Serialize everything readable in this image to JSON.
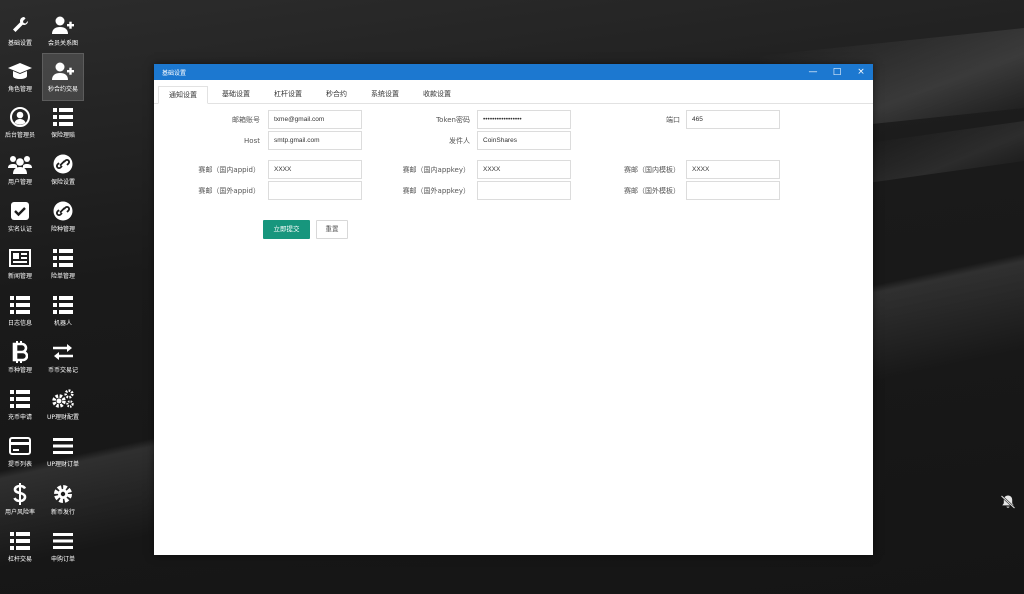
{
  "desktop": {
    "icons": [
      {
        "label": "基础设置",
        "icon": "wrench-icon"
      },
      {
        "label": "会员关系图",
        "icon": "user-add-icon"
      },
      {
        "label": "角色管理",
        "icon": "graduation-cap-icon"
      },
      {
        "label": "秒合约交易",
        "icon": "user-add-icon"
      },
      {
        "label": "后台管理员",
        "icon": "user-circle-icon"
      },
      {
        "label": "保险理赔",
        "icon": "list-icon"
      },
      {
        "label": "用户管理",
        "icon": "users-icon"
      },
      {
        "label": "保险设置",
        "icon": "link-circle-icon"
      },
      {
        "label": "实名认证",
        "icon": "check-square-icon"
      },
      {
        "label": "险种管理",
        "icon": "link-circle-icon"
      },
      {
        "label": "新闻管理",
        "icon": "newspaper-icon"
      },
      {
        "label": "险单管理",
        "icon": "list-icon"
      },
      {
        "label": "日志信息",
        "icon": "list-icon"
      },
      {
        "label": "机器人",
        "icon": "list-icon"
      },
      {
        "label": "币种管理",
        "icon": "bitcoin-icon"
      },
      {
        "label": "币币交易记",
        "icon": "exchange-icon"
      },
      {
        "label": "充币申请",
        "icon": "list-icon"
      },
      {
        "label": "UP理财配置",
        "icon": "gears-icon"
      },
      {
        "label": "提币列表",
        "icon": "credit-card-icon"
      },
      {
        "label": "UP理财订单",
        "icon": "menu-icon"
      },
      {
        "label": "用户风险率",
        "icon": "dollar-icon"
      },
      {
        "label": "新币发行",
        "icon": "gear-icon"
      },
      {
        "label": "杠杆交易",
        "icon": "list-icon"
      },
      {
        "label": "申购订单",
        "icon": "menu-icon"
      }
    ],
    "tray_icon": "bell-off-icon"
  },
  "window": {
    "title": "基础设置",
    "controls": {
      "minimize": "—",
      "maximize": "□",
      "close": "×"
    },
    "tabs": [
      "通知设置",
      "基础设置",
      "杠杆设置",
      "秒合约",
      "系统设置",
      "收款设置"
    ],
    "active_tab": 0,
    "form": {
      "row1": [
        {
          "label": "邮箱账号",
          "value": "txme@gmail.com"
        },
        {
          "label": "Token密码",
          "value": "•••••••••••••••••"
        },
        {
          "label": "端口",
          "value": "465"
        }
      ],
      "row2": [
        {
          "label": "Host",
          "value": "smtp.gmail.com"
        },
        {
          "label": "发件人",
          "value": "CoinShares"
        }
      ],
      "row3": [
        {
          "label": "赛邮（国内appid）",
          "value": "XXXX"
        },
        {
          "label": "赛邮（国内appkey）",
          "value": "XXXX"
        },
        {
          "label": "赛邮（国内模板）",
          "value": "XXXX"
        }
      ],
      "row4": [
        {
          "label": "赛邮（国外appid）",
          "value": ""
        },
        {
          "label": "赛邮（国外appkey）",
          "value": ""
        },
        {
          "label": "赛邮（国外模板）",
          "value": ""
        }
      ],
      "submit_label": "立即提交",
      "reset_label": "重置"
    }
  }
}
